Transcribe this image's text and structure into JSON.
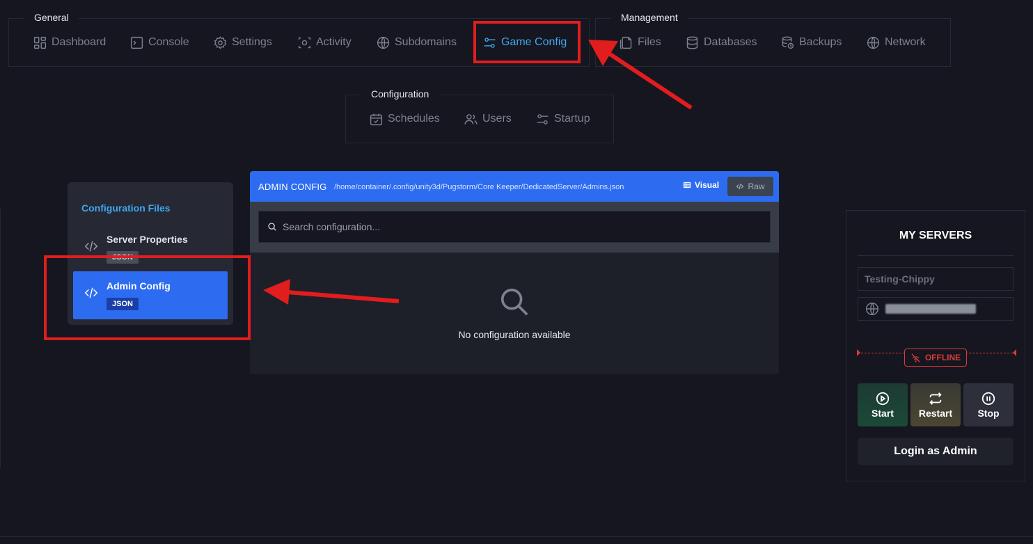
{
  "nav": {
    "general": {
      "label": "General",
      "items": [
        {
          "label": "Dashboard",
          "icon": "dashboard-icon"
        },
        {
          "label": "Console",
          "icon": "console-icon"
        },
        {
          "label": "Settings",
          "icon": "gear-icon"
        },
        {
          "label": "Activity",
          "icon": "activity-icon"
        },
        {
          "label": "Subdomains",
          "icon": "globe-icon"
        },
        {
          "label": "Game Config",
          "icon": "sliders-icon",
          "active": true
        }
      ]
    },
    "management": {
      "label": "Management",
      "items": [
        {
          "label": "Files",
          "icon": "files-icon"
        },
        {
          "label": "Databases",
          "icon": "database-icon"
        },
        {
          "label": "Backups",
          "icon": "backup-icon"
        },
        {
          "label": "Network",
          "icon": "globe-icon"
        }
      ]
    },
    "configuration": {
      "label": "Configuration",
      "items": [
        {
          "label": "Schedules",
          "icon": "calendar-icon"
        },
        {
          "label": "Users",
          "icon": "users-icon"
        },
        {
          "label": "Startup",
          "icon": "sliders-icon"
        }
      ]
    }
  },
  "sidebar": {
    "title": "Configuration Files",
    "files": [
      {
        "name": "Server Properties",
        "badge": "JSON",
        "active": false
      },
      {
        "name": "Admin Config",
        "badge": "JSON",
        "active": true
      }
    ]
  },
  "panel": {
    "title": "ADMIN CONFIG",
    "path": "/home/container/.config/unity3d/Pugstorm/Core Keeper/DedicatedServer/Admins.json",
    "visual_label": "Visual",
    "raw_label": "Raw",
    "search_placeholder": "Search configuration...",
    "empty_text": "No configuration available"
  },
  "servers": {
    "title": "MY SERVERS",
    "server_name": "Testing-Chippy",
    "status": "OFFLINE",
    "start_label": "Start",
    "restart_label": "Restart",
    "stop_label": "Stop",
    "login_label": "Login as Admin"
  },
  "colors": {
    "accent": "#3fa7ee",
    "primary": "#2d6cf0",
    "offline": "#e03a3a",
    "annotation": "#e11d1d",
    "background": "#15161f"
  }
}
